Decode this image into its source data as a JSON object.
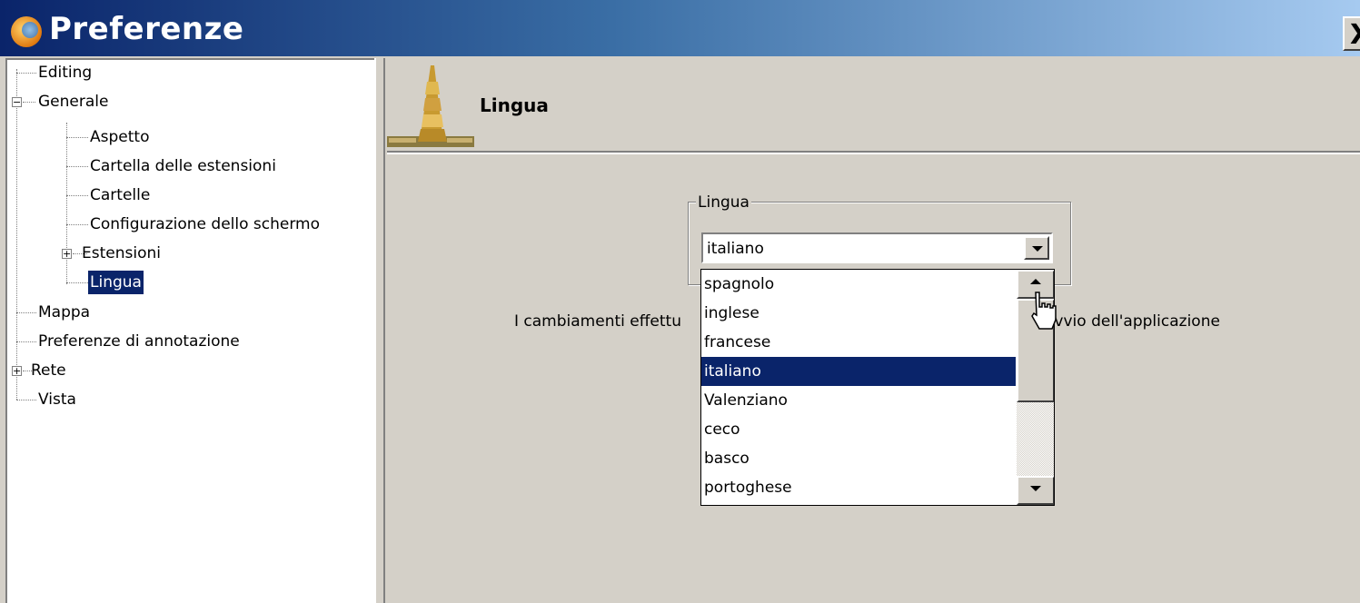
{
  "window": {
    "title": "Preferenze",
    "close_label": "X"
  },
  "tree": {
    "items": [
      {
        "label": "Editing"
      },
      {
        "label": "Generale",
        "expanded": true
      },
      {
        "label": "Aspetto"
      },
      {
        "label": "Cartella delle estensioni"
      },
      {
        "label": "Cartelle"
      },
      {
        "label": "Configurazione dello schermo"
      },
      {
        "label": "Estensioni",
        "expanded": false
      },
      {
        "label": "Lingua",
        "selected": true
      },
      {
        "label": "Mappa"
      },
      {
        "label": "Preferenze di annotazione"
      },
      {
        "label": "Rete",
        "expanded": false
      },
      {
        "label": "Vista"
      }
    ],
    "expander_open": "−",
    "expander_closed": "+"
  },
  "page": {
    "header_title": "Lingua",
    "group_label": "Lingua",
    "combo_value": "italiano",
    "message_left": "I cambiamenti effettu",
    "message_right": "avvio dell'applicazione"
  },
  "dropdown": {
    "options": [
      "spagnolo",
      "inglese",
      "francese",
      "italiano",
      "Valenziano",
      "ceco",
      "basco",
      "portoghese"
    ],
    "selected": "italiano"
  },
  "colors": {
    "selection": "#0a246a",
    "window_bg": "#d4d0c8"
  }
}
